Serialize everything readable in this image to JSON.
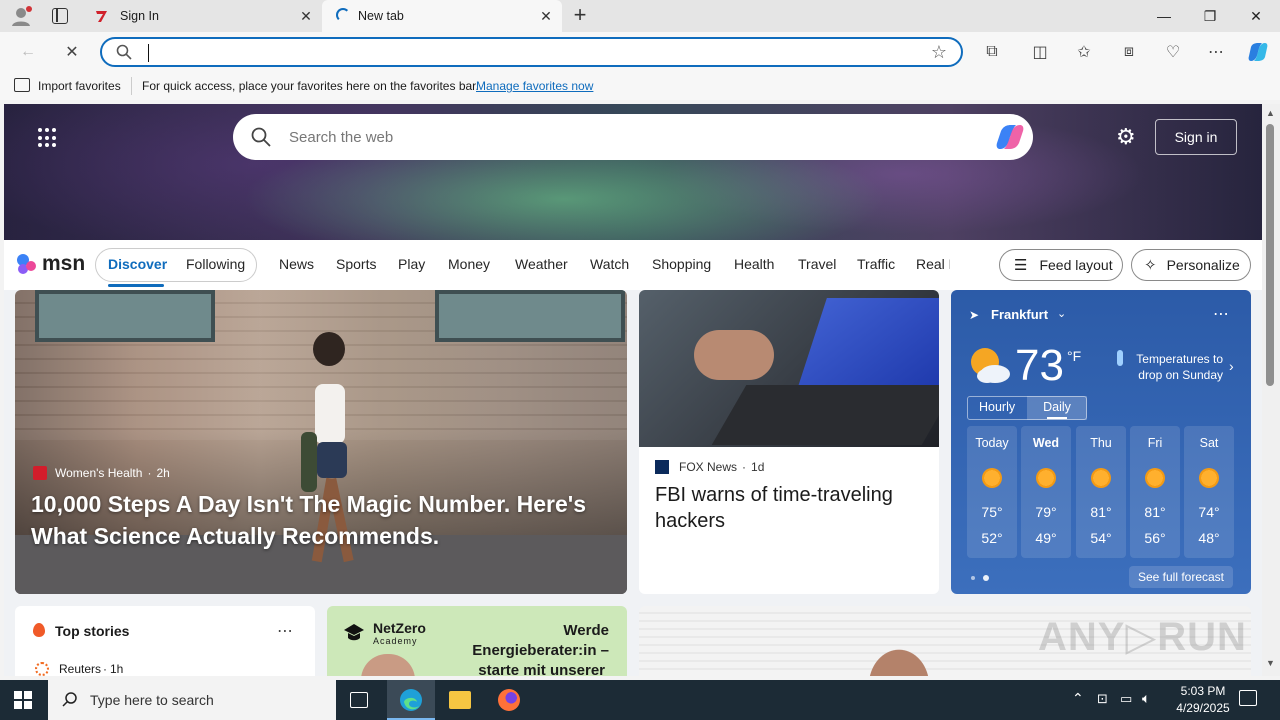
{
  "browser": {
    "tabs": [
      {
        "title": "Sign In"
      },
      {
        "title": "New tab"
      }
    ],
    "address": {
      "value": ""
    },
    "favorites_bar": {
      "import_label": "Import favorites",
      "message": "For quick access, place your favorites here on the favorites bar.",
      "manage_link": "Manage favorites now"
    }
  },
  "msn": {
    "search_placeholder": "Search the web",
    "sign_in_label": "Sign in",
    "logo_text": "msn",
    "feed_tabs": [
      "Discover",
      "Following"
    ],
    "nav_items": [
      "News",
      "Sports",
      "Play",
      "Money",
      "Weather",
      "Watch",
      "Shopping",
      "Health",
      "Travel",
      "Traffic",
      "Real E"
    ],
    "feed_layout_label": "Feed layout",
    "personalize_label": "Personalize",
    "main_story": {
      "source": "Women's Health",
      "age": "2h",
      "headline": "10,000 Steps A Day Isn't The Magic Number. Here's What Science Actually Recommends."
    },
    "second_story": {
      "source": "FOX News",
      "age": "1d",
      "headline": "FBI warns of time-traveling hackers"
    },
    "weather": {
      "location": "Frankfurt",
      "temp": "73",
      "unit": "°F",
      "alert": "Temperatures to drop on Sunday",
      "tabs": [
        "Hourly",
        "Daily"
      ],
      "days": [
        {
          "day": "Today",
          "hi": "75°",
          "lo": "52°"
        },
        {
          "day": "Wed",
          "hi": "79°",
          "lo": "49°"
        },
        {
          "day": "Thu",
          "hi": "81°",
          "lo": "54°"
        },
        {
          "day": "Fri",
          "hi": "81°",
          "lo": "56°"
        },
        {
          "day": "Sat",
          "hi": "74°",
          "lo": "48°"
        }
      ],
      "see_full": "See full forecast"
    },
    "top_stories": {
      "title": "Top stories",
      "first_source": "Reuters",
      "first_age": "1h"
    },
    "ad": {
      "brand": "NetZero",
      "brand_sub": "Academy",
      "line1": "Werde",
      "line2": "Energieberater:in –",
      "line3": "starte mit unserer"
    }
  },
  "taskbar": {
    "search_placeholder": "Type here to search",
    "time": "5:03 PM",
    "date": "4/29/2025"
  }
}
